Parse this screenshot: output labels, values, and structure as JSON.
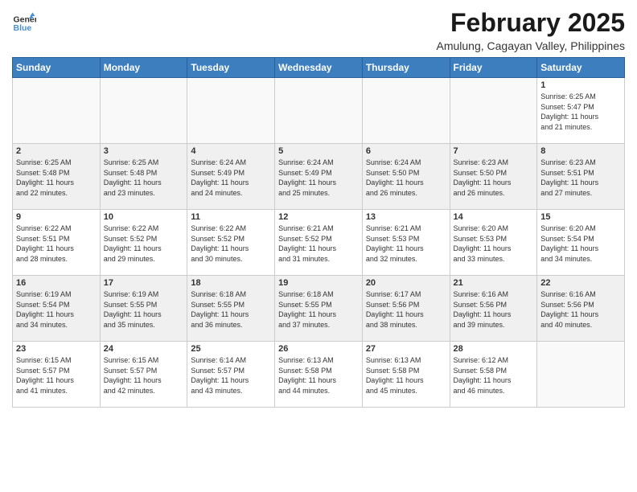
{
  "logo": {
    "line1": "General",
    "line2": "Blue"
  },
  "title": "February 2025",
  "subtitle": "Amulung, Cagayan Valley, Philippines",
  "days_of_week": [
    "Sunday",
    "Monday",
    "Tuesday",
    "Wednesday",
    "Thursday",
    "Friday",
    "Saturday"
  ],
  "weeks": [
    [
      {
        "day": "",
        "info": ""
      },
      {
        "day": "",
        "info": ""
      },
      {
        "day": "",
        "info": ""
      },
      {
        "day": "",
        "info": ""
      },
      {
        "day": "",
        "info": ""
      },
      {
        "day": "",
        "info": ""
      },
      {
        "day": "1",
        "info": "Sunrise: 6:25 AM\nSunset: 5:47 PM\nDaylight: 11 hours\nand 21 minutes."
      }
    ],
    [
      {
        "day": "2",
        "info": "Sunrise: 6:25 AM\nSunset: 5:48 PM\nDaylight: 11 hours\nand 22 minutes."
      },
      {
        "day": "3",
        "info": "Sunrise: 6:25 AM\nSunset: 5:48 PM\nDaylight: 11 hours\nand 23 minutes."
      },
      {
        "day": "4",
        "info": "Sunrise: 6:24 AM\nSunset: 5:49 PM\nDaylight: 11 hours\nand 24 minutes."
      },
      {
        "day": "5",
        "info": "Sunrise: 6:24 AM\nSunset: 5:49 PM\nDaylight: 11 hours\nand 25 minutes."
      },
      {
        "day": "6",
        "info": "Sunrise: 6:24 AM\nSunset: 5:50 PM\nDaylight: 11 hours\nand 26 minutes."
      },
      {
        "day": "7",
        "info": "Sunrise: 6:23 AM\nSunset: 5:50 PM\nDaylight: 11 hours\nand 26 minutes."
      },
      {
        "day": "8",
        "info": "Sunrise: 6:23 AM\nSunset: 5:51 PM\nDaylight: 11 hours\nand 27 minutes."
      }
    ],
    [
      {
        "day": "9",
        "info": "Sunrise: 6:22 AM\nSunset: 5:51 PM\nDaylight: 11 hours\nand 28 minutes."
      },
      {
        "day": "10",
        "info": "Sunrise: 6:22 AM\nSunset: 5:52 PM\nDaylight: 11 hours\nand 29 minutes."
      },
      {
        "day": "11",
        "info": "Sunrise: 6:22 AM\nSunset: 5:52 PM\nDaylight: 11 hours\nand 30 minutes."
      },
      {
        "day": "12",
        "info": "Sunrise: 6:21 AM\nSunset: 5:52 PM\nDaylight: 11 hours\nand 31 minutes."
      },
      {
        "day": "13",
        "info": "Sunrise: 6:21 AM\nSunset: 5:53 PM\nDaylight: 11 hours\nand 32 minutes."
      },
      {
        "day": "14",
        "info": "Sunrise: 6:20 AM\nSunset: 5:53 PM\nDaylight: 11 hours\nand 33 minutes."
      },
      {
        "day": "15",
        "info": "Sunrise: 6:20 AM\nSunset: 5:54 PM\nDaylight: 11 hours\nand 34 minutes."
      }
    ],
    [
      {
        "day": "16",
        "info": "Sunrise: 6:19 AM\nSunset: 5:54 PM\nDaylight: 11 hours\nand 34 minutes."
      },
      {
        "day": "17",
        "info": "Sunrise: 6:19 AM\nSunset: 5:55 PM\nDaylight: 11 hours\nand 35 minutes."
      },
      {
        "day": "18",
        "info": "Sunrise: 6:18 AM\nSunset: 5:55 PM\nDaylight: 11 hours\nand 36 minutes."
      },
      {
        "day": "19",
        "info": "Sunrise: 6:18 AM\nSunset: 5:55 PM\nDaylight: 11 hours\nand 37 minutes."
      },
      {
        "day": "20",
        "info": "Sunrise: 6:17 AM\nSunset: 5:56 PM\nDaylight: 11 hours\nand 38 minutes."
      },
      {
        "day": "21",
        "info": "Sunrise: 6:16 AM\nSunset: 5:56 PM\nDaylight: 11 hours\nand 39 minutes."
      },
      {
        "day": "22",
        "info": "Sunrise: 6:16 AM\nSunset: 5:56 PM\nDaylight: 11 hours\nand 40 minutes."
      }
    ],
    [
      {
        "day": "23",
        "info": "Sunrise: 6:15 AM\nSunset: 5:57 PM\nDaylight: 11 hours\nand 41 minutes."
      },
      {
        "day": "24",
        "info": "Sunrise: 6:15 AM\nSunset: 5:57 PM\nDaylight: 11 hours\nand 42 minutes."
      },
      {
        "day": "25",
        "info": "Sunrise: 6:14 AM\nSunset: 5:57 PM\nDaylight: 11 hours\nand 43 minutes."
      },
      {
        "day": "26",
        "info": "Sunrise: 6:13 AM\nSunset: 5:58 PM\nDaylight: 11 hours\nand 44 minutes."
      },
      {
        "day": "27",
        "info": "Sunrise: 6:13 AM\nSunset: 5:58 PM\nDaylight: 11 hours\nand 45 minutes."
      },
      {
        "day": "28",
        "info": "Sunrise: 6:12 AM\nSunset: 5:58 PM\nDaylight: 11 hours\nand 46 minutes."
      },
      {
        "day": "",
        "info": ""
      }
    ]
  ]
}
